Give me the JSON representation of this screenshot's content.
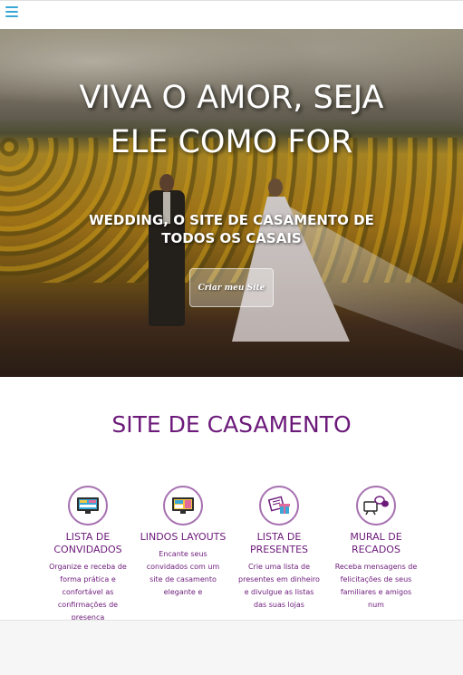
{
  "header": {
    "menu_icon": "hamburger-menu-icon",
    "accent": "#3aa8d6"
  },
  "hero": {
    "title": "VIVA O AMOR, SEJA ELE COMO FOR",
    "subtitle": "WEDDING, O SITE DE CASAMENTO DE TODOS OS CASAIS",
    "cta_label": "Criar meu Site"
  },
  "section": {
    "title": "SITE DE CASAMENTO",
    "title_color": "#6c1a7a",
    "features": [
      {
        "icon": "monitor-guest-list-icon",
        "title": "LISTA DE CONVIDADOS",
        "description": "Organize e receba de forma prática e confortável as confirmações de presença"
      },
      {
        "icon": "monitor-layout-icon",
        "title": "LINDOS LAYOUTS",
        "description": "Encante seus convidados com um site de casamento elegante e"
      },
      {
        "icon": "gift-list-icon",
        "title": "LISTA DE PRESENTES",
        "description": "Crie uma lista de presentes em dinheiro e divulgue as listas das suas lojas"
      },
      {
        "icon": "message-board-icon",
        "title": "MURAL DE RECADOS",
        "description": "Receba mensagens de felicitações de seus familiares e amigos num"
      }
    ]
  }
}
